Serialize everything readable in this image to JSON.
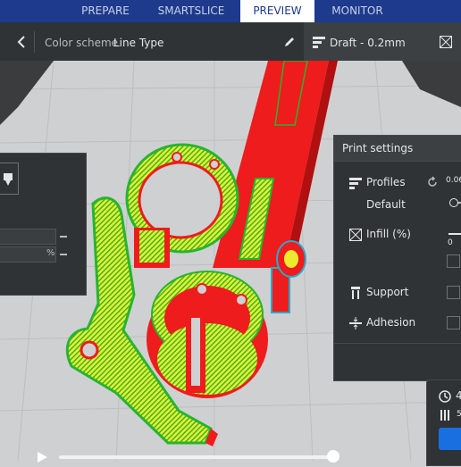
{
  "nav": {
    "tabs": [
      {
        "label": "PREPARE",
        "active": false
      },
      {
        "label": "SMARTSLICE",
        "active": false
      },
      {
        "label": "PREVIEW",
        "active": true
      },
      {
        "label": "MONITOR",
        "active": false
      }
    ]
  },
  "view_bar": {
    "back_icon": "chevron-left-icon",
    "color_scheme_label": "Color scheme",
    "color_scheme_value": "Line Type",
    "edit_icon": "pencil-icon"
  },
  "profile_bar": {
    "profile_icon": "stacked-lines-icon",
    "profile_text": "Draft - 0.2mm",
    "infill_icon": "infill-pattern-icon"
  },
  "left_panel": {
    "unit_label": "%",
    "icons": [
      "printer-head-icon"
    ]
  },
  "print_settings": {
    "title": "Print settings",
    "profiles_label": "Profiles",
    "profiles_value": "0.06",
    "default_label": "Default",
    "infill_label": "Infill (%)",
    "infill_value": "0",
    "support_label": "Support",
    "adhesion_label": "Adhesion",
    "support_checked": false,
    "adhesion_checked": false,
    "reset_icon": "reset-icon"
  },
  "estimate_panel": {
    "time_value": "4",
    "material_value": "5",
    "clock_icon": "clock-icon",
    "spool_icon": "filament-icon"
  },
  "playback": {
    "play_icon": "play-icon",
    "progress": 1.0
  },
  "colors": {
    "accent": "#1d3a8c",
    "button_blue": "#1a6fe0",
    "panel_bg": "#2f3335",
    "shell_red": "#ee1c1c",
    "infill_yellow": "#ecec2e",
    "skin_green": "#27b42f",
    "build_plate": "#cfd0d2"
  }
}
